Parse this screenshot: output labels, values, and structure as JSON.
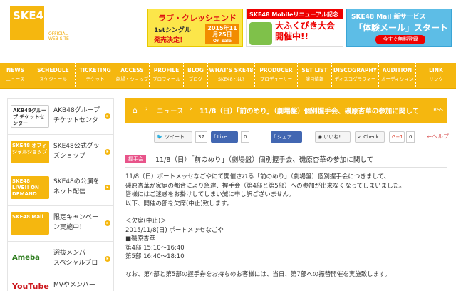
{
  "header": {
    "logo": "SKE48",
    "logo_sub1": "OFFICIAL",
    "logo_sub2": "WEB SITE",
    "banner1": {
      "title": "ラブ・クレッシェンド",
      "line": "1stシングル",
      "badge_date": "2015年11月25日",
      "badge_label": "On Sale",
      "release": "発売決定！"
    },
    "banner2": {
      "top": "SKE48 Mobileリニューアル記念",
      "main1": "大ふくびき大会",
      "main2": "開催中!!"
    },
    "banner3": {
      "top": "SKE48 Mail 新サービス",
      "main": "「体験メール」スタート",
      "button": "今すぐ無料登録"
    }
  },
  "nav": [
    {
      "en": "NEWS",
      "jp": "ニュース"
    },
    {
      "en": "SCHEDULE",
      "jp": "スケジュール"
    },
    {
      "en": "TICKETING",
      "jp": "チケット"
    },
    {
      "en": "ACCESS",
      "jp": "劇場・ショップ"
    },
    {
      "en": "PROFILE",
      "jp": "プロフィール"
    },
    {
      "en": "BLOG",
      "jp": "ブログ"
    },
    {
      "en": "WHAT'S SKE48",
      "jp": "SKE48とは?"
    },
    {
      "en": "PRODUCER",
      "jp": "プロデューサー"
    },
    {
      "en": "SET LIST",
      "jp": "演目情報"
    },
    {
      "en": "DISCOGRAPHY",
      "jp": "ディスコグラフィー"
    },
    {
      "en": "AUDITION",
      "jp": "オーディション"
    },
    {
      "en": "LINK",
      "jp": "リンク"
    }
  ],
  "sidebar": [
    {
      "logo": "AKB48グループ チケットセンター",
      "label1": "AKB48グループ",
      "label2": "チケットセンタ",
      "color": "#ffffff",
      "text_color": "#333333"
    },
    {
      "logo": "SKE48 オフィシャルショップ",
      "label1": "SKE48公式グッ",
      "label2": "ズショップ",
      "color": "#f5b70f",
      "text_color": "#ffffff"
    },
    {
      "logo": "SKE48 LIVE!! ON DEMAND",
      "label1": "SKE48の公演を",
      "label2": "ネット配信",
      "color": "#f5b70f",
      "text_color": "#ffffff"
    },
    {
      "logo": "SKE48 Mail",
      "label1": "限定キャンペー",
      "label2": "ン実施中！",
      "color": "#f5b70f",
      "text_color": "#ffffff"
    },
    {
      "logo": "Ameba",
      "label1": "選抜メンバー",
      "label2": "スペシャルブロ",
      "color": "#ffffff",
      "text_color": "#2a7a1a"
    },
    {
      "logo": "YouTube",
      "label1": "MVやメンバー",
      "label2": "",
      "color": "#ffffff",
      "text_color": "#cc181e"
    }
  ],
  "breadcrumb": {
    "home": "⌂",
    "news": "ニュース",
    "title": "11/8（日）「前のめり」（劇場盤）個別握手会、磯原杏華の参加に関して",
    "rss": "RSS"
  },
  "social": {
    "tweet": "ツイート",
    "tweet_count": "37",
    "like": "Like",
    "like_count": "0",
    "share": "シェア",
    "iine": "いいね!",
    "check": "Check",
    "gplus": "G+1",
    "gplus_count": "0",
    "help": "←ヘルプ"
  },
  "article": {
    "tag": "握手会",
    "title": "11/8（日）「前のめり」（劇場盤）個別握手会、磯原杏華の参加に関して",
    "lines": [
      "11/8（日）ポートメッセなごやにて開催される「前のめり」（劇場盤）個別握手会につきまして、",
      "磯原杏華が家庭の都合により急遽、握手会（第4部と第5部）への参加が出来なくなってしまいました。",
      "皆様にはご迷惑をお掛けしてしまい誠に申し訳ございません。",
      "以下、開催の部を欠席(中止)致します。"
    ],
    "absence_header": "＜欠席(中止)＞",
    "absence_place": "2015/11/8(日) ポートメッセなごや",
    "member": "■磯原杏華",
    "part4": "第4部 15:10～16:40",
    "part5": "第5部 16:40～18:10",
    "last": "なお、第4部と第5部の握手券をお持ちのお客様には、当日、第7部への振替開催を実施致します。"
  }
}
